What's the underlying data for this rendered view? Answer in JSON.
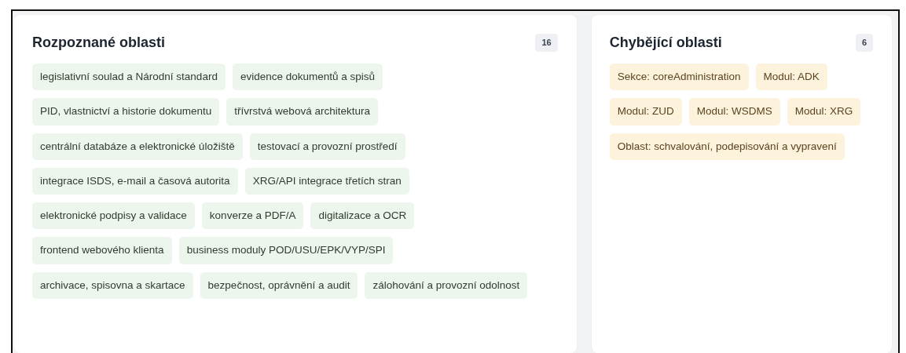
{
  "panels": [
    {
      "title": "Rozpoznané oblasti",
      "count": "16",
      "kind": "recognized",
      "items": [
        "legislativní soulad a Národní standard",
        "evidence dokumentů a spisů",
        "PID, vlastnictví a historie dokumentu",
        "třívrstvá webová architektura",
        "centrální databáze a elektronické úložiště",
        "testovací a provozní prostředí",
        "integrace ISDS, e-mail a časová autorita",
        "XRG/API integrace třetích stran",
        "elektronické podpisy a validace",
        "konverze a PDF/A",
        "digitalizace a OCR",
        "frontend webového klienta",
        "business moduly POD/USU/EPK/VYP/SPI",
        "archivace, spisovna a skartace",
        "bezpečnost, oprávnění a audit",
        "zálohování a provozní odolnost"
      ]
    },
    {
      "title": "Chybějící oblasti",
      "count": "6",
      "kind": "missing",
      "items": [
        "Sekce: coreAdministration",
        "Modul: ADK",
        "Modul: ZUD",
        "Modul: WSDMS",
        "Modul: XRG",
        "Oblast: schvalování, podepisování a vypravení"
      ]
    }
  ]
}
